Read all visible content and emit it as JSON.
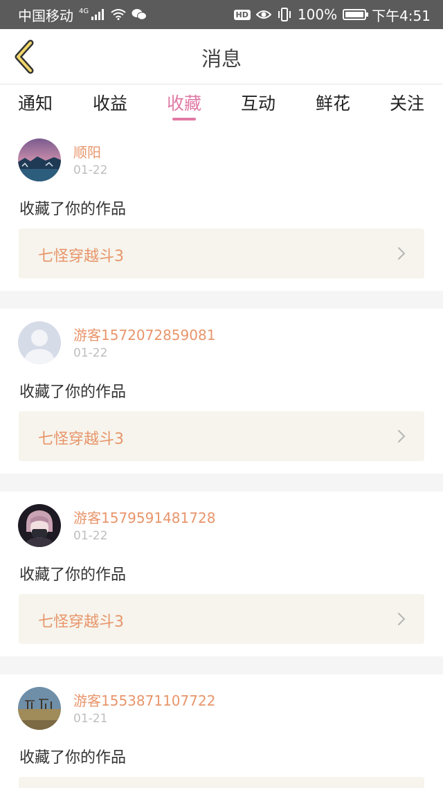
{
  "status_bar": {
    "carrier": "中国移动",
    "network": "4G",
    "battery": "100%",
    "time": "下午4:51",
    "icons": [
      "signal-icon",
      "wifi-icon",
      "wechat-icon",
      "hd-icon",
      "eye-icon",
      "vibrate-icon",
      "battery-icon"
    ]
  },
  "nav": {
    "title": "消息",
    "back_icon": "chevron-left-icon"
  },
  "tabs": [
    {
      "label": "通知",
      "active": false
    },
    {
      "label": "收益",
      "active": false
    },
    {
      "label": "收藏",
      "active": true
    },
    {
      "label": "互动",
      "active": false
    },
    {
      "label": "鲜花",
      "active": false
    },
    {
      "label": "关注",
      "active": false
    }
  ],
  "colors": {
    "accent_pink": "#e07aa5",
    "username_orange": "#e8956b",
    "work_box_bg": "#f6f4ec"
  },
  "messages": [
    {
      "username": "顺阳",
      "date": "01-22",
      "text": "收藏了你的作品",
      "work": "七怪穿越斗3",
      "avatar": "landscape-avatar"
    },
    {
      "username": "游客1572072859081",
      "date": "01-22",
      "text": "收藏了你的作品",
      "work": "七怪穿越斗3",
      "avatar": "default-avatar"
    },
    {
      "username": "游客1579591481728",
      "date": "01-22",
      "text": "收藏了你的作品",
      "work": "七怪穿越斗3",
      "avatar": "anime-avatar"
    },
    {
      "username": "游客1553871107722",
      "date": "01-21",
      "text": "收藏了你的作品",
      "work": "",
      "avatar": "field-avatar"
    }
  ]
}
